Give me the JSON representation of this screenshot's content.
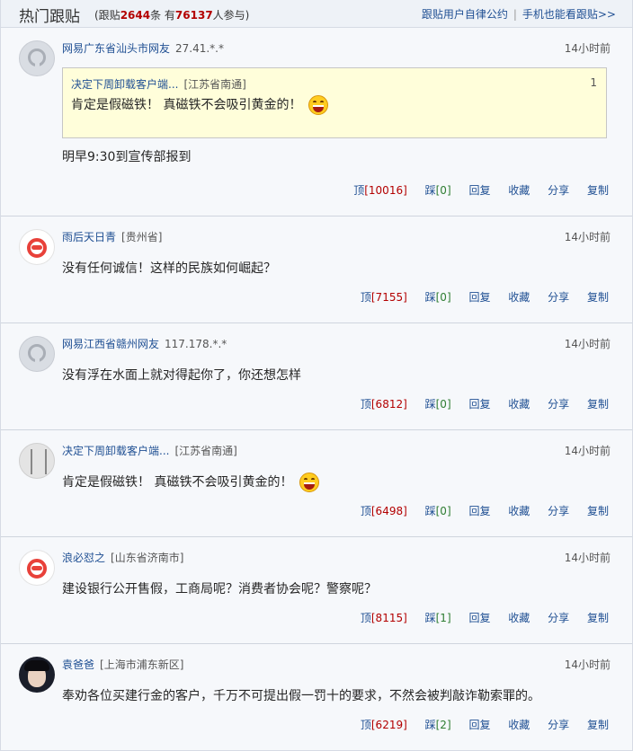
{
  "header": {
    "title": "热门跟贴",
    "stats_prefix": "(跟贴",
    "reply_count": "2644",
    "stats_mid": "条 有",
    "participants": "76137",
    "stats_suffix": "人参与)",
    "link_rules": "跟贴用户自律公约",
    "separator": "|",
    "link_mobile": "手机也能看跟贴>>"
  },
  "action_labels": {
    "up": "顶",
    "down": "踩",
    "reply": "回复",
    "favorite": "收藏",
    "share": "分享",
    "copy": "复制"
  },
  "comments": [
    {
      "avatar": "default-avatar",
      "user": "网易广东省汕头市网友",
      "location": "27.41.*.*",
      "time": "14小时前",
      "quote": {
        "user": "决定下周卸载客户端...",
        "location": "[江苏省南通]",
        "floor": "1",
        "text": "肯定是假磁铁！ 真磁铁不会吸引黄金的！"
      },
      "text": "明早9:30到宣传部报到",
      "up": "[10016]",
      "down": "[0]"
    },
    {
      "avatar": "netease-logo-avatar",
      "user": "雨后天日青",
      "location": "[贵州省]",
      "time": "14小时前",
      "text": "没有任何诚信！这样的民族如何崛起？",
      "up": "[7155]",
      "down": "[0]"
    },
    {
      "avatar": "default-avatar",
      "user": "网易江西省赣州网友",
      "location": "117.178.*.*",
      "time": "14小时前",
      "text": "没有浮在水面上就对得起你了，你还想怎样",
      "up": "[6812]",
      "down": "[0]"
    },
    {
      "avatar": "pattern-avatar",
      "user": "决定下周卸载客户端...",
      "location": "[江苏省南通]",
      "time": "14小时前",
      "text": "肯定是假磁铁！ 真磁铁不会吸引黄金的！",
      "up": "[6498]",
      "down": "[0]"
    },
    {
      "avatar": "netease-logo-avatar",
      "user": "浪必怼之",
      "location": "[山东省济南市]",
      "time": "14小时前",
      "text": "建设银行公开售假，工商局呢？消费者协会呢？警察呢？",
      "up": "[8115]",
      "down": "[1]"
    },
    {
      "avatar": "photo-avatar",
      "user": "袁爸爸",
      "location": "[上海市浦东新区]",
      "time": "14小时前",
      "text": "奉劝各位买建行金的客户，千万不可提出假一罚十的要求，不然会被判敲诈勒索罪的。",
      "up": "[6219]",
      "down": "[2]"
    }
  ]
}
